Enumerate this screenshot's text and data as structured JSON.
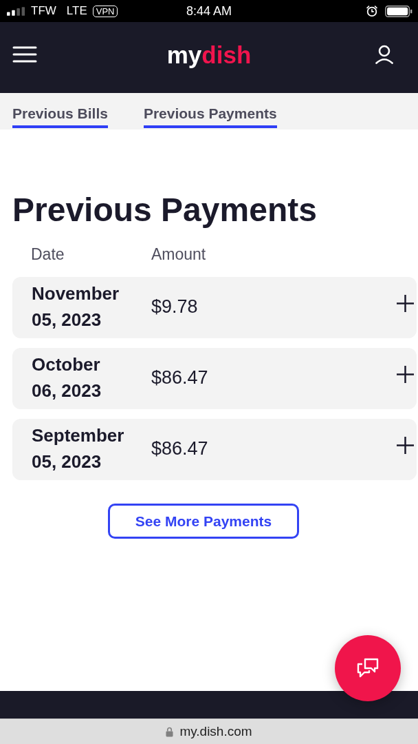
{
  "status_bar": {
    "carrier": "TFW",
    "network": "LTE",
    "vpn": "VPN",
    "time": "8:44 AM"
  },
  "header": {
    "logo": {
      "prefix": "my",
      "name": "dish"
    }
  },
  "tabs": [
    {
      "label": "Previous Bills",
      "selected": true
    },
    {
      "label": "Previous Payments",
      "selected": true
    }
  ],
  "page_title": "Previous Payments",
  "table": {
    "columns": [
      "Date",
      "Amount"
    ],
    "rows": [
      {
        "date": "November 05, 2023",
        "amount": "$9.78",
        "expanded": false
      },
      {
        "date": "October 06, 2023",
        "amount": "$86.47",
        "expanded": false
      },
      {
        "date": "September 05, 2023",
        "amount": "$86.47",
        "expanded": false
      }
    ]
  },
  "see_more_button": "See More Payments",
  "browser": {
    "url": "my.dish.com"
  }
}
